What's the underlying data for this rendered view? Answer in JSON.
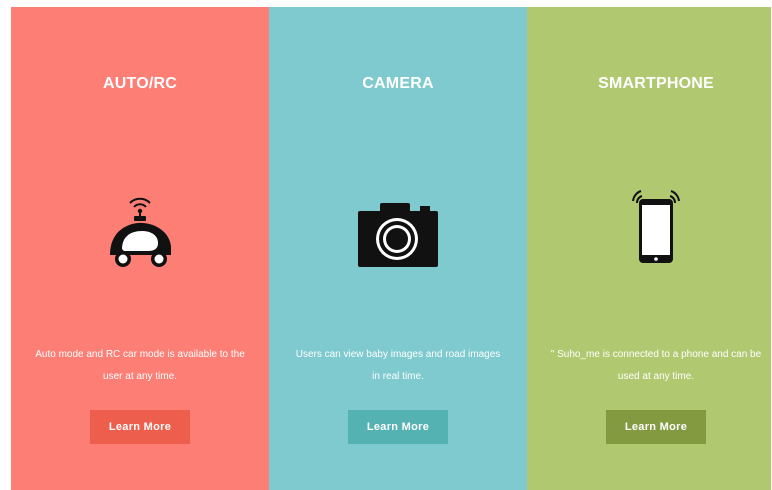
{
  "colors": {
    "panel1_bg": "#fd7e75",
    "panel1_btn": "#ee5e4d",
    "panel2_bg": "#7ecace",
    "panel2_btn": "#55b2b2",
    "panel3_bg": "#b0c970",
    "panel3_btn": "#849a41",
    "icon": "#111111"
  },
  "panels": [
    {
      "title": "AUTO/RC",
      "icon": "autonomous-car-icon",
      "description": "Auto mode and RC car mode is available to the user at any time.",
      "button_label": "Learn More"
    },
    {
      "title": "CAMERA",
      "icon": "camera-icon",
      "description": "Users can view baby images and road images in real time.",
      "button_label": "Learn More"
    },
    {
      "title": "SMARTPHONE",
      "icon": "smartphone-icon",
      "description": "\" Suho_me is connected to a phone and can be used at any time.",
      "button_label": "Learn More"
    }
  ]
}
